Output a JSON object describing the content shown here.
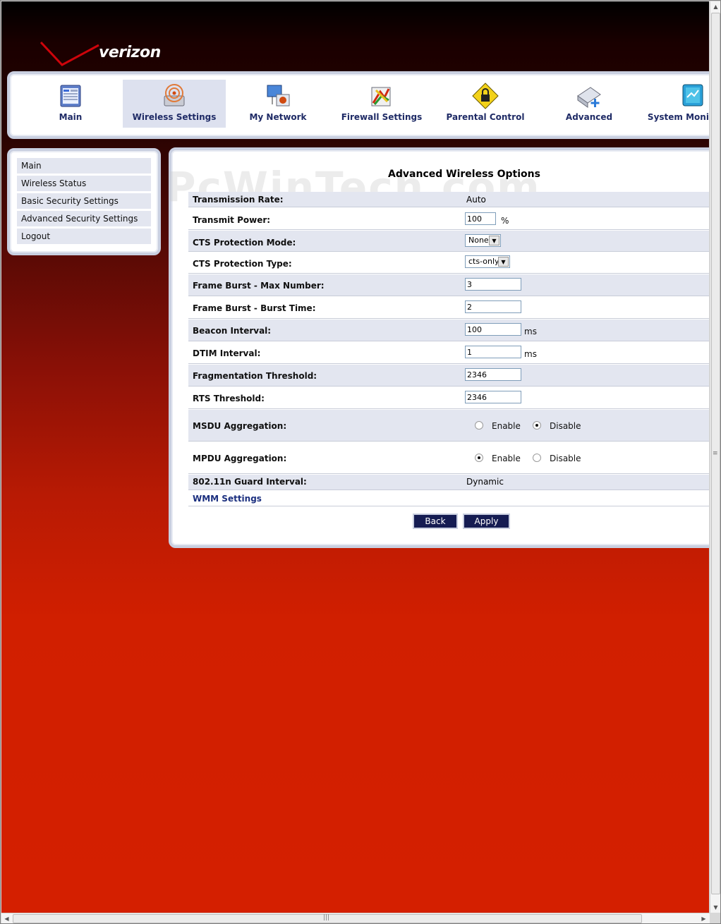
{
  "brand": {
    "logo_text": "verizon",
    "logo_color": "#cd040b"
  },
  "watermark": "PcWinTech.com",
  "topnav": [
    {
      "label": "Main",
      "icon": "main-icon"
    },
    {
      "label": "Wireless Settings",
      "icon": "wireless-icon"
    },
    {
      "label": "My Network",
      "icon": "network-icon"
    },
    {
      "label": "Firewall Settings",
      "icon": "firewall-icon"
    },
    {
      "label": "Parental Control",
      "icon": "lock-icon"
    },
    {
      "label": "Advanced",
      "icon": "advanced-icon"
    },
    {
      "label": "System Monitoring",
      "icon": "monitor-icon"
    }
  ],
  "sidebar": {
    "items": [
      "Main",
      "Wireless Status",
      "Basic Security Settings",
      "Advanced Security Settings",
      "Logout"
    ]
  },
  "main": {
    "title": "Advanced Wireless Options",
    "transmission_rate": {
      "label": "Transmission Rate:",
      "value": "Auto"
    },
    "transmit_power": {
      "label": "Transmit Power:",
      "value": "100",
      "unit": "%"
    },
    "cts_mode": {
      "label": "CTS Protection Mode:",
      "value": "None"
    },
    "cts_type": {
      "label": "CTS Protection Type:",
      "value": "cts-only"
    },
    "frame_burst_max": {
      "label": "Frame Burst - Max Number:",
      "value": "3"
    },
    "frame_burst_time": {
      "label": "Frame Burst - Burst Time:",
      "value": "2"
    },
    "beacon": {
      "label": "Beacon Interval:",
      "value": "100",
      "unit": "ms"
    },
    "dtim": {
      "label": "DTIM Interval:",
      "value": "1",
      "unit": "ms"
    },
    "frag": {
      "label": "Fragmentation Threshold:",
      "value": "2346"
    },
    "rts": {
      "label": "RTS Threshold:",
      "value": "2346"
    },
    "msdu": {
      "label": "MSDU Aggregation:",
      "enable": "Enable",
      "disable": "Disable",
      "selected": "Disable"
    },
    "mpdu": {
      "label": "MPDU Aggregation:",
      "enable": "Enable",
      "disable": "Disable",
      "selected": "Enable"
    },
    "guard": {
      "label": "802.11n Guard Interval:",
      "value": "Dynamic"
    },
    "wmm_link": "WMM Settings",
    "back_label": "Back",
    "apply_label": "Apply"
  }
}
